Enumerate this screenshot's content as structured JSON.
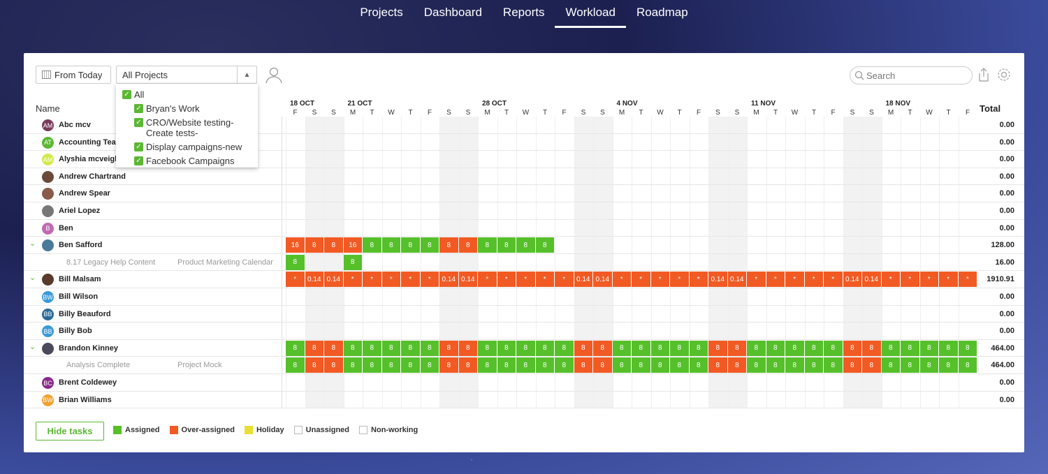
{
  "nav": {
    "items": [
      "Projects",
      "Dashboard",
      "Reports",
      "Workload",
      "Roadmap"
    ],
    "active": "Workload"
  },
  "toolbar": {
    "from_today_label": "From Today",
    "project_select_value": "All Projects",
    "search_placeholder": "Search"
  },
  "dropdown": {
    "items": [
      {
        "label": "All",
        "checked": true
      },
      {
        "label": "Bryan's Work",
        "checked": true
      },
      {
        "label": "CRO/Website testing- Create tests-",
        "checked": true
      },
      {
        "label": "Display campaigns-new",
        "checked": true
      },
      {
        "label": "Facebook Campaigns",
        "checked": true
      }
    ]
  },
  "table": {
    "name_header": "Name",
    "total_header": "Total",
    "week_labels": [
      "18 OCT",
      "21 OCT",
      "28 OCT",
      "4 NOV",
      "11 NOV",
      "18 NOV"
    ],
    "day_labels": [
      "F",
      "S",
      "S",
      "M",
      "T",
      "W",
      "T",
      "F",
      "S",
      "S",
      "M",
      "T",
      "W",
      "T",
      "F",
      "S",
      "S",
      "M",
      "T",
      "W",
      "T",
      "F",
      "S",
      "S",
      "M",
      "T",
      "W",
      "T",
      "F",
      "S",
      "S",
      "M",
      "T",
      "W",
      "T",
      "F"
    ],
    "rows": [
      {
        "name": "Abc mcv",
        "initials": "AM",
        "avatar_color": "#7b3a5a",
        "total": "0.00"
      },
      {
        "name": "Accounting Team",
        "initials": "AT",
        "avatar_color": "#5bb833",
        "total": "0.00"
      },
      {
        "name": "Alyshia mcveigh",
        "initials": "AM",
        "avatar_color": "#d4e84a",
        "total": "0.00"
      },
      {
        "name": "Andrew Chartrand",
        "initials": "",
        "avatar_color": "#6b4a3a",
        "total": "0.00"
      },
      {
        "name": "Andrew Spear",
        "initials": "",
        "avatar_color": "#8a5a4a",
        "total": "0.00"
      },
      {
        "name": "Ariel Lopez",
        "initials": "",
        "avatar_color": "#777777",
        "total": "0.00"
      },
      {
        "name": "Ben",
        "initials": "B",
        "avatar_color": "#c06ab0",
        "total": "0.00"
      },
      {
        "name": "Ben Safford",
        "initials": "",
        "avatar_color": "#4a7a9a",
        "total": "128.00",
        "expanded": true,
        "cells": [
          "16",
          "8",
          "8",
          "16",
          "8",
          "8",
          "8",
          "8",
          "8",
          "8",
          "8",
          "8",
          "8",
          "8"
        ],
        "cell_types": [
          "o",
          "o",
          "o",
          "o",
          "g",
          "g",
          "g",
          "g",
          "o",
          "o",
          "g",
          "g",
          "g",
          "g"
        ]
      },
      {
        "task": "8.17 Legacy Help Content",
        "project": "Product Marketing Calendar",
        "total": "16.00",
        "cells": [
          "8",
          "",
          "",
          "8"
        ],
        "cell_types": [
          "g",
          "",
          "",
          "g"
        ]
      },
      {
        "name": "Bill Malsam",
        "initials": "",
        "avatar_color": "#5a3a2a",
        "total": "1910.91",
        "expanded": true,
        "cells": [
          "*",
          "0.14",
          "0.14",
          "*",
          "*",
          "*",
          "*",
          "*",
          "0.14",
          "0.14",
          "*",
          "*",
          "*",
          "*",
          "*",
          "0.14",
          "0.14",
          "*",
          "*",
          "*",
          "*",
          "*",
          "0.14",
          "0.14",
          "*",
          "*",
          "*",
          "*",
          "*",
          "0.14",
          "0.14",
          "*",
          "*",
          "*",
          "*",
          "*"
        ],
        "cell_types": "o"
      },
      {
        "name": "Bill Wilson",
        "initials": "BW",
        "avatar_color": "#3a9ad8",
        "total": "0.00"
      },
      {
        "name": "Billy Beauford",
        "initials": "BB",
        "avatar_color": "#2a6a9a",
        "total": "0.00"
      },
      {
        "name": "Billy Bob",
        "initials": "BB",
        "avatar_color": "#3a9ad8",
        "total": "0.00"
      },
      {
        "name": "Brandon Kinney",
        "initials": "",
        "avatar_color": "#4a4a5a",
        "total": "464.00",
        "expanded": true,
        "cells": [
          "8",
          "8",
          "8",
          "8",
          "8",
          "8",
          "8",
          "8",
          "8",
          "8",
          "8",
          "8",
          "8",
          "8",
          "8",
          "8",
          "8",
          "8",
          "8",
          "8",
          "8",
          "8",
          "8",
          "8",
          "8",
          "8",
          "8",
          "8",
          "8",
          "8",
          "8",
          "8",
          "8",
          "8",
          "8",
          "8"
        ],
        "cell_types": [
          "g",
          "o",
          "o",
          "g",
          "g",
          "g",
          "g",
          "g",
          "o",
          "o",
          "g",
          "g",
          "g",
          "g",
          "g",
          "o",
          "o",
          "g",
          "g",
          "g",
          "g",
          "g",
          "o",
          "o",
          "g",
          "g",
          "g",
          "g",
          "g",
          "o",
          "o",
          "g",
          "g",
          "g",
          "g",
          "g"
        ]
      },
      {
        "task": "Analysis Complete",
        "project": "Project Mock",
        "total": "464.00",
        "cells": [
          "8",
          "8",
          "8",
          "8",
          "8",
          "8",
          "8",
          "8",
          "8",
          "8",
          "8",
          "8",
          "8",
          "8",
          "8",
          "8",
          "8",
          "8",
          "8",
          "8",
          "8",
          "8",
          "8",
          "8",
          "8",
          "8",
          "8",
          "8",
          "8",
          "8",
          "8",
          "8",
          "8",
          "8",
          "8",
          "8"
        ],
        "cell_types": [
          "g",
          "o",
          "o",
          "g",
          "g",
          "g",
          "g",
          "g",
          "o",
          "o",
          "g",
          "g",
          "g",
          "g",
          "g",
          "o",
          "o",
          "g",
          "g",
          "g",
          "g",
          "g",
          "o",
          "o",
          "g",
          "g",
          "g",
          "g",
          "g",
          "o",
          "o",
          "g",
          "g",
          "g",
          "g",
          "g"
        ]
      },
      {
        "name": "Brent Coldewey",
        "initials": "BC",
        "avatar_color": "#8a2a8a",
        "total": "0.00"
      },
      {
        "name": "Brian Williams",
        "initials": "BW",
        "avatar_color": "#f0a030",
        "total": "0.00"
      }
    ]
  },
  "footer": {
    "hide_tasks_label": "Hide tasks",
    "legend": [
      {
        "label": "Assigned",
        "color": "#56c02b"
      },
      {
        "label": "Over-assigned",
        "color": "#f25a24"
      },
      {
        "label": "Holiday",
        "color": "#e8e030"
      },
      {
        "label": "Unassigned",
        "color": "#ffffff"
      },
      {
        "label": "Non-working",
        "color": "#ffffff"
      }
    ]
  },
  "colors": {
    "assigned": "#56c02b",
    "over_assigned": "#f25a24",
    "accent": "#5bb833"
  }
}
